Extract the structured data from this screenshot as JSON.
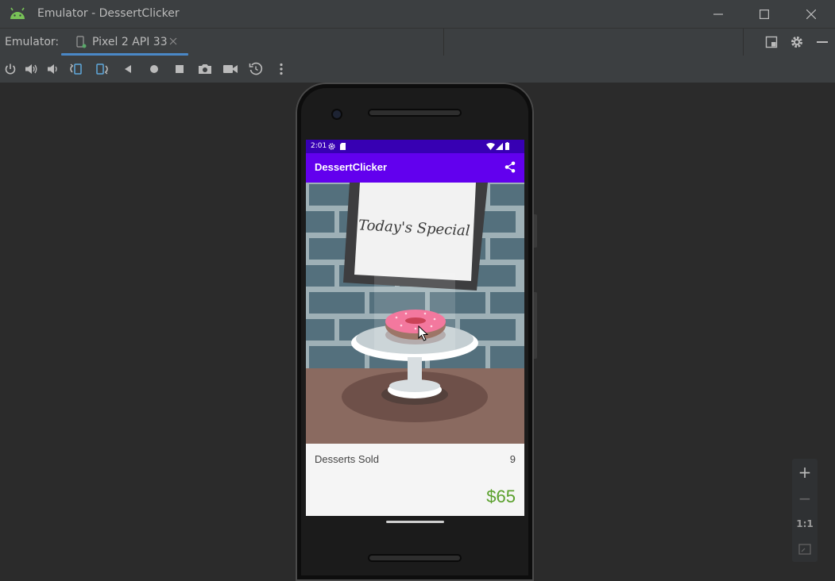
{
  "window": {
    "title": "Emulator - DessertClicker",
    "icons": {
      "app": "android-icon",
      "minimize": "minimize-icon",
      "maximize": "maximize-icon",
      "close": "close-icon"
    }
  },
  "tabbar": {
    "label": "Emulator:",
    "tab": {
      "label": "Pixel 2 API 33",
      "icon": "device-icon",
      "close_icon": "close-tab-icon"
    },
    "tools": [
      "window-mode-icon",
      "gear-icon",
      "hide-icon"
    ]
  },
  "toolbar": {
    "buttons": [
      "power-icon",
      "volume-up-icon",
      "volume-down-icon",
      "rotate-left-icon",
      "rotate-right-icon",
      "back-icon",
      "home-icon",
      "overview-icon",
      "camera-icon",
      "screen-record-icon",
      "snapshot-icon",
      "more-icon"
    ]
  },
  "device": {
    "status": {
      "time": "2:01"
    },
    "app": {
      "title": "DessertClicker",
      "share_icon": "share-icon",
      "sign_text": "Today's Special",
      "desserts_sold_label": "Desserts Sold",
      "desserts_sold_value": "9",
      "revenue": "$65"
    }
  },
  "zoom": {
    "zoom_in": "+",
    "zoom_out": "−",
    "actual_size": "1:1",
    "fit_icon": "fit-screen-icon"
  },
  "colors": {
    "ide_bg": "#2b2b2b",
    "ide_panel": "#3c3f41",
    "tab_accent": "#4a88c7",
    "status_bar": "#3700b3",
    "app_bar": "#6200ee",
    "revenue_green": "#5aa02c"
  }
}
